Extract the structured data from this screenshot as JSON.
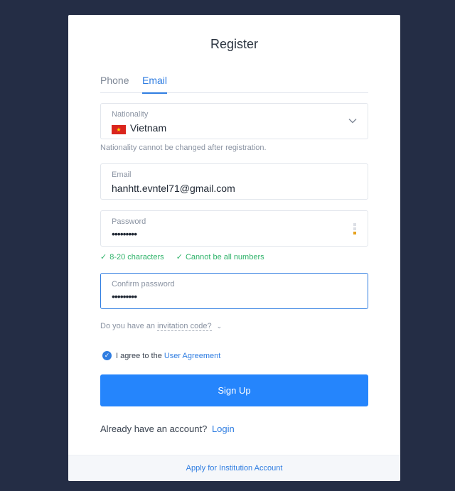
{
  "title": "Register",
  "tabs": [
    {
      "label": "Phone",
      "active": false
    },
    {
      "label": "Email",
      "active": true
    }
  ],
  "nationality": {
    "label": "Nationality",
    "value": "Vietnam",
    "flag_icon": "vietnam-flag-icon",
    "hint": "Nationality cannot be changed after registration."
  },
  "email": {
    "label": "Email",
    "value": "hanhtt.evntel71@gmail.com"
  },
  "password": {
    "label": "Password",
    "value": "•••••••••",
    "strength_levels": 3,
    "strength_active": 1,
    "strength_color": "#e6a21e"
  },
  "password_rules": [
    {
      "icon": "✓",
      "text": "8-20 characters",
      "ok": true
    },
    {
      "icon": "✓",
      "text": "Cannot be all numbers",
      "ok": true
    }
  ],
  "confirm_password": {
    "label": "Confirm password",
    "value": "•••••••••"
  },
  "invitation": {
    "prefix": "Do you have an",
    "link": "invitation code?",
    "chevron": "⌄"
  },
  "agreement": {
    "checked": true,
    "check_icon": "✓",
    "text": "I agree to the",
    "link": "User Agreement"
  },
  "signup_label": "Sign Up",
  "login_prompt": {
    "text": "Already have an account?",
    "link": "Login"
  },
  "footer_link": "Apply for Institution Account",
  "colors": {
    "accent": "#2f7de1",
    "button": "#2585fc",
    "success": "#2fb36a",
    "background": "#242d45"
  }
}
